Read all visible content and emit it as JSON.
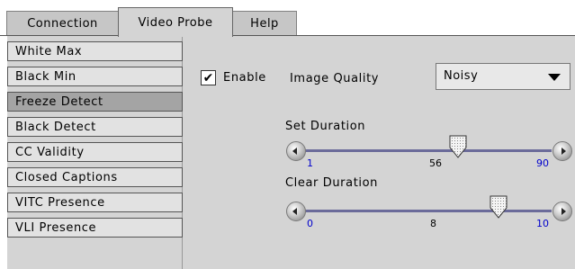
{
  "tabs": [
    {
      "label": "Connection",
      "active": false
    },
    {
      "label": "Video Probe",
      "active": true
    },
    {
      "label": "Help",
      "active": false
    }
  ],
  "sidebar": {
    "items": [
      {
        "label": "White Max"
      },
      {
        "label": "Black Min"
      },
      {
        "label": "Freeze Detect",
        "selected": true
      },
      {
        "label": "Black Detect"
      },
      {
        "label": "CC Validity"
      },
      {
        "label": "Closed Captions"
      },
      {
        "label": "VITC Presence"
      },
      {
        "label": "VLI Presence"
      }
    ]
  },
  "settings": {
    "enable_label": "Enable",
    "enable_checked": true,
    "image_quality_label": "Image Quality",
    "image_quality_value": "Noisy",
    "set_duration": {
      "label": "Set Duration",
      "min": "1",
      "value": "56",
      "max": "90"
    },
    "clear_duration": {
      "label": "Clear Duration",
      "min": "0",
      "value": "8",
      "max": "10"
    }
  },
  "colors": {
    "panel_bg": "#d4d4d4",
    "selected_item": "#a4a4a4",
    "track": "#6b6b9a",
    "range_label": "#0000cc"
  },
  "icons": {
    "checkbox_mark": "checkmark-icon",
    "dropdown": "triangle-down-icon",
    "slider_left": "left-arrow-icon",
    "slider_right": "right-arrow-icon",
    "thumb": "slider-thumb-icon"
  }
}
